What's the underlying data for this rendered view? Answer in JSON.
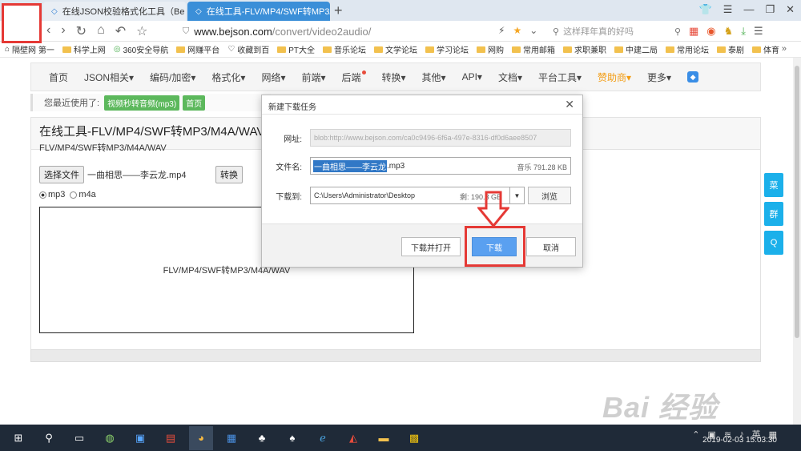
{
  "browser": {
    "tabs": [
      {
        "label": "在线JSON校验格式化工具（Be",
        "active": false
      },
      {
        "label": "在线工具-FLV/MP4/SWF转MP3/",
        "active": true
      }
    ],
    "url_host": "www.bejson.com",
    "url_path": "/convert/video2audio/",
    "search_placeholder": "这样拜年真的好吗",
    "bookmarks": [
      "隔壁网 第一",
      "科学上网",
      "360安全导航",
      "网赚平台",
      "收藏到百",
      "PT大全",
      "音乐论坛",
      "文学论坛",
      "学习论坛",
      "网购",
      "常用邮箱",
      "求职兼职",
      "中建二局",
      "常用论坛",
      "泰剧",
      "体育"
    ],
    "bookmarks_more": "»"
  },
  "site": {
    "menu": [
      {
        "label": "首页"
      },
      {
        "label": "JSON相关▾"
      },
      {
        "label": "编码/加密▾"
      },
      {
        "label": "格式化▾"
      },
      {
        "label": "网络▾"
      },
      {
        "label": "前端▾"
      },
      {
        "label": "后端"
      },
      {
        "label": "转换▾"
      },
      {
        "label": "其他▾"
      },
      {
        "label": "API▾"
      },
      {
        "label": "文档▾"
      },
      {
        "label": "平台工具▾"
      },
      {
        "label": "赞助商▾"
      },
      {
        "label": "更多▾"
      }
    ],
    "recent_label": "您最近使用了:",
    "recent_tags": [
      "视频秒转音频(mp3)",
      "首页"
    ],
    "panel_title": "在线工具-FLV/MP4/SWF转MP3/M4A/WAV",
    "panel_subtitle": "FLV/MP4/SWF转MP3/M4A/WAV",
    "choose_file_label": "选择文件",
    "chosen_file": "一曲相思——李云龙.mp4",
    "convert_label": "转换",
    "format_mp3": "mp3",
    "format_m4a": "m4a",
    "preview_text": "FLV/MP4/SWF转MP3/M4A/WAV",
    "side_buttons": [
      "菜",
      "群",
      "Q"
    ]
  },
  "dialog": {
    "title": "新建下载任务",
    "url_label": "网址:",
    "url_value": "blob:http://www.bejson.com/ca0c9496-6f6a-497e-8316-df0d6aee8507",
    "filename_label": "文件名:",
    "filename_selected": "一曲相思——李云龙",
    "filename_ext": ".mp3",
    "file_size": "音乐 791.28 KB",
    "saveto_label": "下载到:",
    "saveto_path": "C:\\Users\\Administrator\\Desktop",
    "free_space": "剩: 190.3 GB",
    "browse_label": "浏览",
    "open_label": "下载并打开",
    "download_label": "下载",
    "cancel_label": "取消"
  },
  "taskbar": {
    "clock": "2019-02-03  15:03:30",
    "ime": "英"
  },
  "watermark": {
    "main": "Bai 经验",
    "sub": "jingyan.baidu.com"
  },
  "colors": {
    "highlight": "#e53935",
    "download_button": "#5aa0f0",
    "tab_active": "#3b8fd8",
    "tag_green": "#5cb85c"
  }
}
